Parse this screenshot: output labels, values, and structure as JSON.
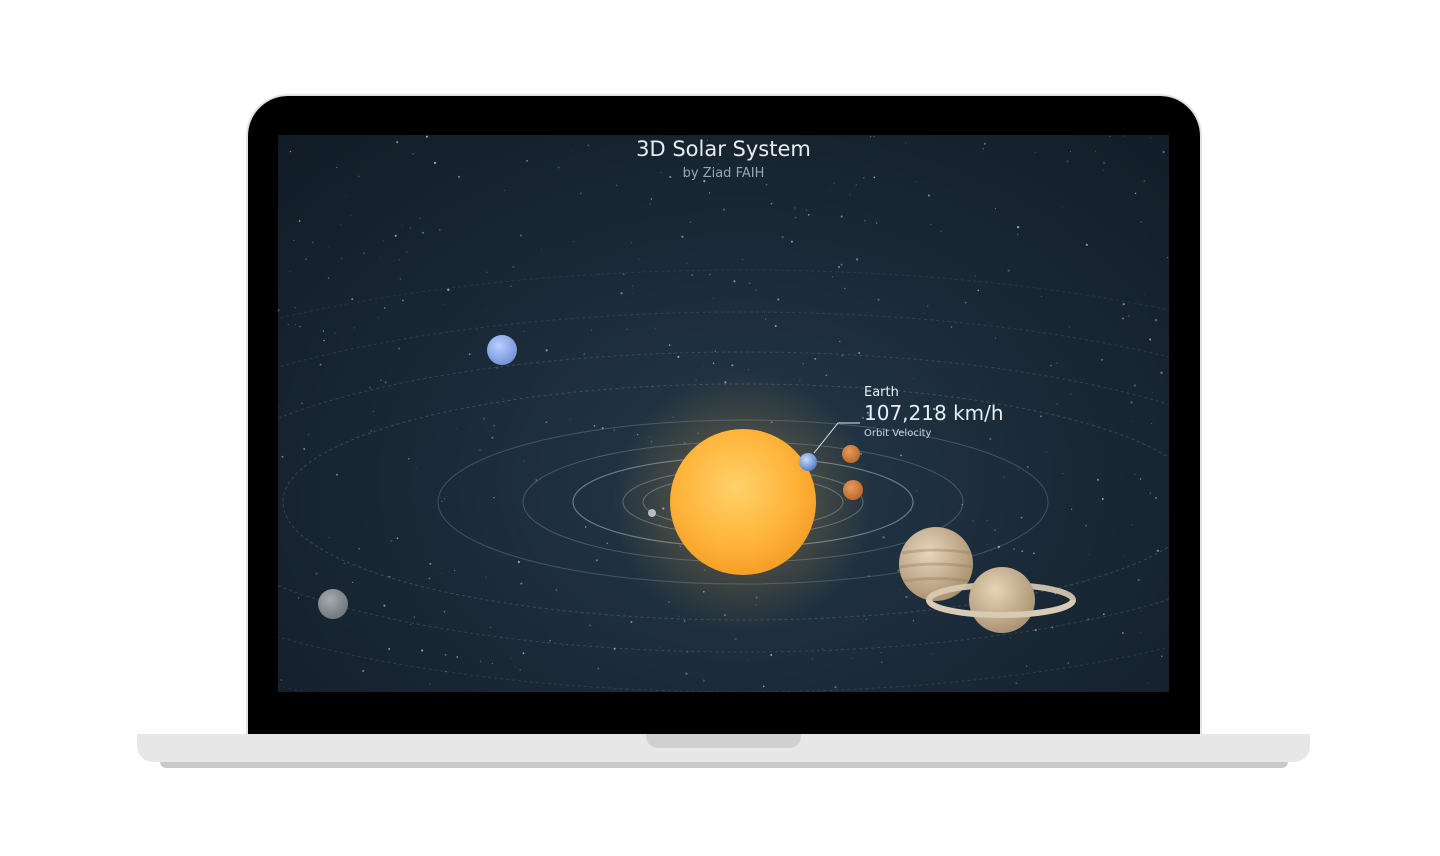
{
  "app": {
    "title": "3D Solar System",
    "subtitle": "by Ziad FAIH"
  },
  "hud": {
    "planet": "Earth",
    "velocity": "107,218 km/h",
    "label": "Orbit Velocity"
  },
  "colors": {
    "space_bg": "#1b2a38",
    "sun": "#ffb43a",
    "orbit_line": "#8a9aa6"
  },
  "icons": {
    "sun": "sun-icon",
    "earth": "earth-icon",
    "saturn_ring": "saturn-ring-icon"
  }
}
